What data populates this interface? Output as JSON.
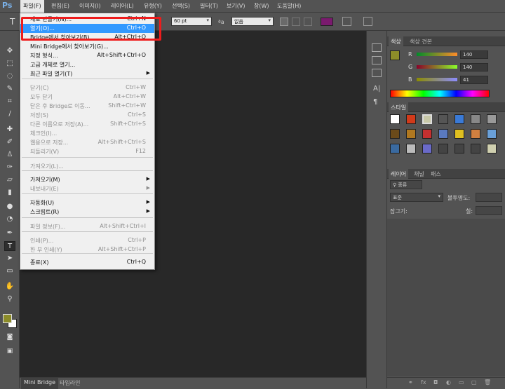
{
  "app": {
    "logo": "Ps"
  },
  "menubar": {
    "items": [
      {
        "label": "파일(F)"
      },
      {
        "label": "편집(E)"
      },
      {
        "label": "이미지(I)"
      },
      {
        "label": "레이어(L)"
      },
      {
        "label": "유형(Y)"
      },
      {
        "label": "선택(S)"
      },
      {
        "label": "필터(T)"
      },
      {
        "label": "보기(V)"
      },
      {
        "label": "창(W)"
      },
      {
        "label": "도움말(H)"
      }
    ]
  },
  "options": {
    "font_size": "60 pt",
    "aa_label": "ªa",
    "antialias": "없음",
    "text_color": "#7a1a6e"
  },
  "file_menu": {
    "items": [
      {
        "label": "새로 만들기(N)...",
        "shortcut": "Ctrl+N",
        "disabled": false,
        "selected": false
      },
      {
        "label": "열기(O)...",
        "shortcut": "Ctrl+O",
        "disabled": false,
        "selected": true
      },
      {
        "label": "Bridge에서 찾아보기(B)...",
        "shortcut": "Alt+Ctrl+O",
        "disabled": false,
        "selected": false
      },
      {
        "label": "Mini Bridge에서 찾아보기(G)...",
        "shortcut": "",
        "disabled": false,
        "selected": false
      },
      {
        "label": "지정 형식...",
        "shortcut": "Alt+Shift+Ctrl+O",
        "disabled": false,
        "selected": false
      },
      {
        "label": "고급 개체로 열기...",
        "shortcut": "",
        "disabled": false,
        "selected": false
      },
      {
        "label": "최근 파일 열기(T)",
        "shortcut": "",
        "disabled": false,
        "selected": false,
        "submenu": true
      },
      {
        "label": "닫기(C)",
        "shortcut": "Ctrl+W",
        "disabled": true,
        "selected": false
      },
      {
        "label": "모두 닫기",
        "shortcut": "Alt+Ctrl+W",
        "disabled": true,
        "selected": false
      },
      {
        "label": "닫은 후 Bridge로 이동...",
        "shortcut": "Shift+Ctrl+W",
        "disabled": true,
        "selected": false
      },
      {
        "label": "저장(S)",
        "shortcut": "Ctrl+S",
        "disabled": true,
        "selected": false
      },
      {
        "label": "다른 이름으로 저장(A)...",
        "shortcut": "Shift+Ctrl+S",
        "disabled": true,
        "selected": false
      },
      {
        "label": "체크인(I)...",
        "shortcut": "",
        "disabled": true,
        "selected": false
      },
      {
        "label": "웹용으로 저장...",
        "shortcut": "Alt+Shift+Ctrl+S",
        "disabled": true,
        "selected": false
      },
      {
        "label": "되돌리기(V)",
        "shortcut": "F12",
        "disabled": true,
        "selected": false
      },
      {
        "label": "가져오기(L)...",
        "shortcut": "",
        "disabled": true,
        "selected": false
      },
      {
        "label": "가져오기(M)",
        "shortcut": "",
        "disabled": false,
        "selected": false,
        "submenu": true
      },
      {
        "label": "내보내기(E)",
        "shortcut": "",
        "disabled": true,
        "selected": false,
        "submenu": true
      },
      {
        "label": "자동화(U)",
        "shortcut": "",
        "disabled": false,
        "selected": false,
        "submenu": true
      },
      {
        "label": "스크립트(R)",
        "shortcut": "",
        "disabled": false,
        "selected": false,
        "submenu": true
      },
      {
        "label": "파일 정보(F)...",
        "shortcut": "Alt+Shift+Ctrl+I",
        "disabled": true,
        "selected": false
      },
      {
        "label": "인쇄(P)...",
        "shortcut": "Ctrl+P",
        "disabled": true,
        "selected": false
      },
      {
        "label": "한 부 인쇄(Y)",
        "shortcut": "Alt+Shift+Ctrl+P",
        "disabled": true,
        "selected": false
      },
      {
        "label": "종료(X)",
        "shortcut": "Ctrl+Q",
        "disabled": false,
        "selected": false
      }
    ]
  },
  "color_panel": {
    "tabs": [
      "색상",
      "색상 견본"
    ],
    "r_label": "R",
    "g_label": "G",
    "b_label": "B",
    "r": "140",
    "g": "140",
    "b": "41",
    "foreground": "#8c8c29"
  },
  "styles_panel": {
    "tab": "스타일"
  },
  "layers_panel": {
    "tabs": [
      "레이어",
      "채널",
      "패스"
    ],
    "kind": "종류",
    "blend": "표준",
    "opacity_label": "불투명도:",
    "lock_label": "잠그기:",
    "fill_label": "칠:"
  },
  "bottom_tabs": [
    "Mini Bridge",
    "타임라인"
  ]
}
